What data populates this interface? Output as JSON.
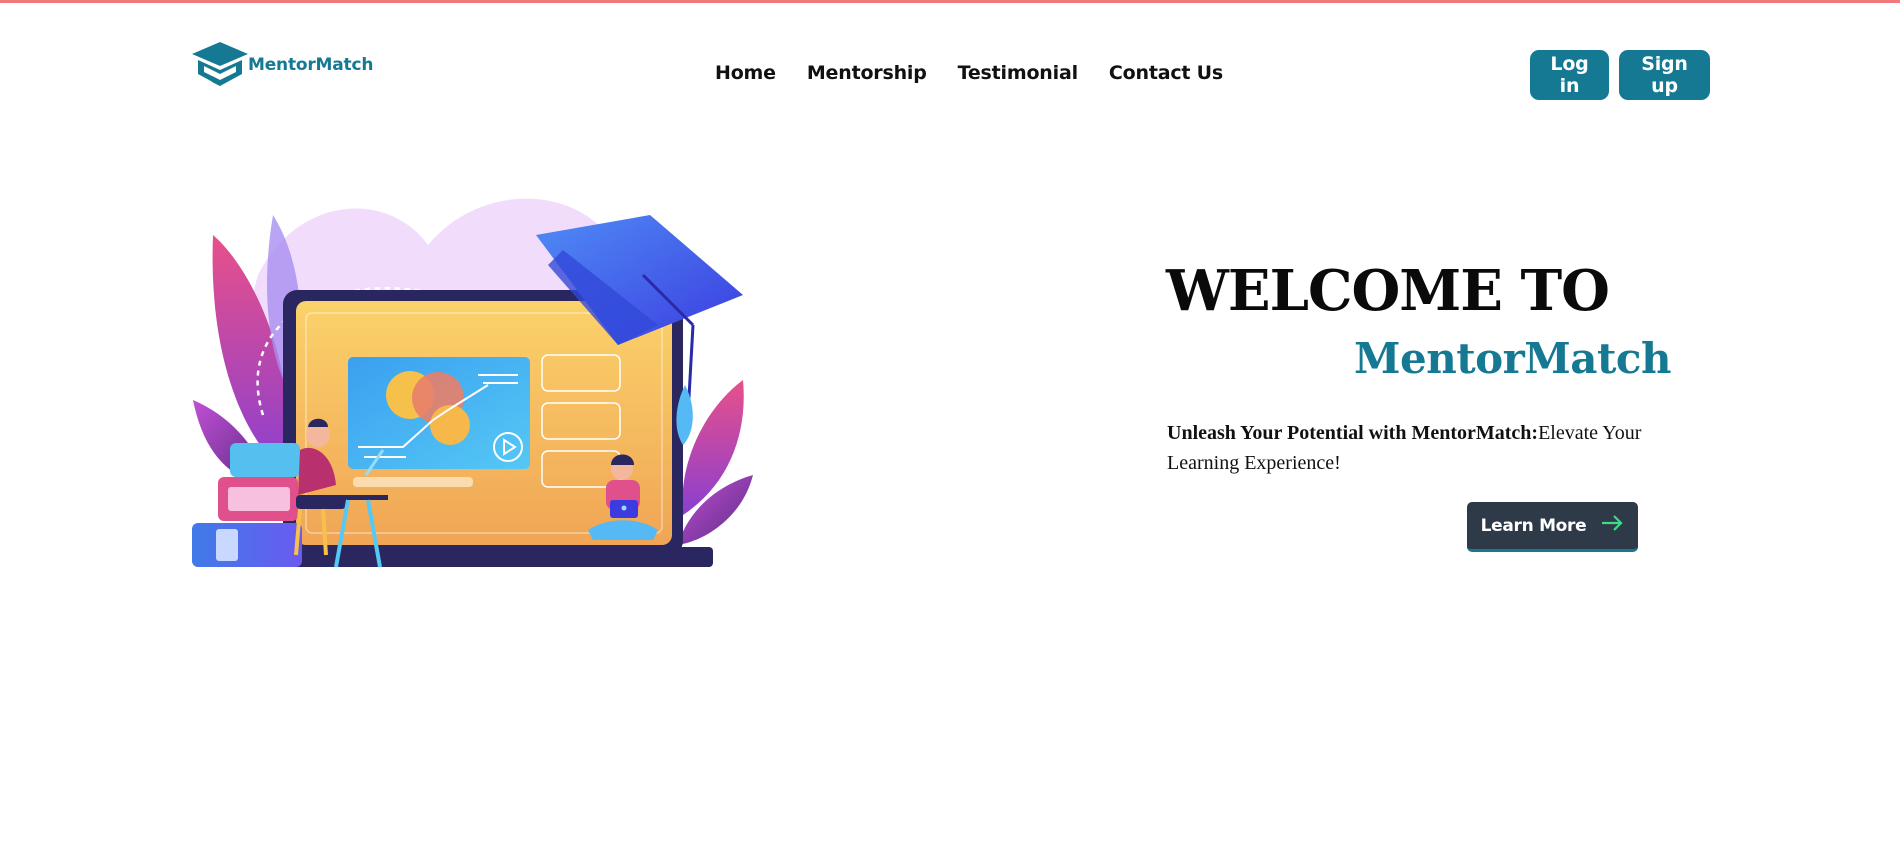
{
  "brand": {
    "name": "MentorMatch",
    "color": "#157993"
  },
  "nav": {
    "items": [
      {
        "label": "Home"
      },
      {
        "label": "Mentorship"
      },
      {
        "label": "Testimonial"
      },
      {
        "label": "Contact Us"
      }
    ]
  },
  "auth": {
    "login_label": "Log in",
    "signup_label": "Sign up"
  },
  "hero": {
    "title": "WELCOME TO",
    "brand": "MentorMatch",
    "tagline_bold": "Unleash Your Potential with MentorMatch:",
    "tagline_rest": "Elevate Your Learning Experience!",
    "cta_label": "Learn More"
  },
  "icons": {
    "logo": "graduation-cap-logo-icon",
    "cta": "arrow-right-icon",
    "illustration": "online-learning-illustration"
  },
  "colors": {
    "accent": "#157993",
    "top_border": "#f07a7a",
    "cta_bg": "#2f3a48",
    "arrow": "#3ddc84"
  }
}
